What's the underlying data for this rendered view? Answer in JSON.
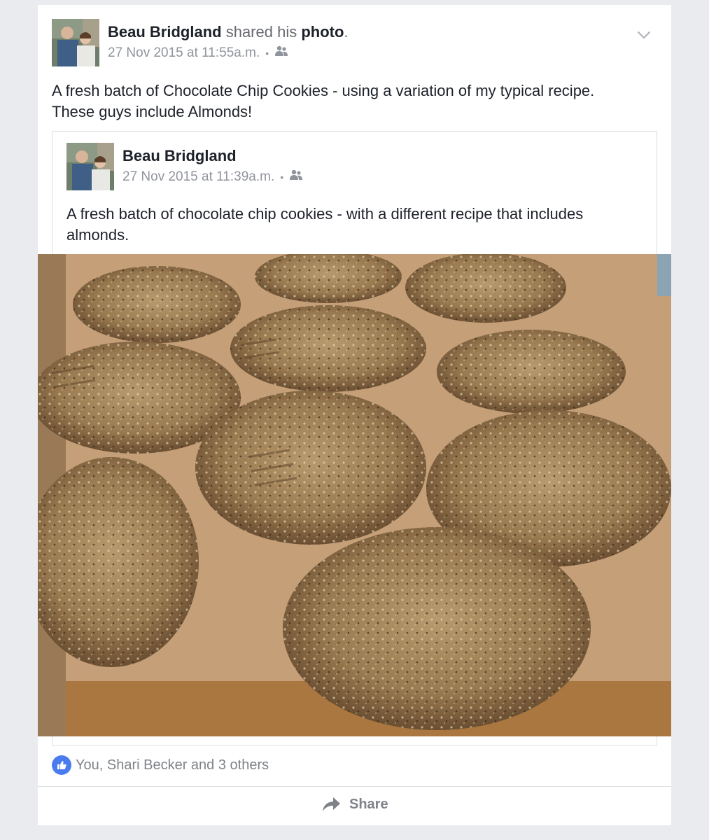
{
  "post": {
    "author": "Beau Bridgland",
    "action_prefix": "shared his",
    "action_object": "photo",
    "action_suffix": ".",
    "timestamp": "27 Nov 2015 at 11:55a.m.",
    "separator": "•",
    "audience_icon": "friends-icon",
    "text_line1": "A fresh batch of Chocolate Chip Cookies - using a variation of my typical recipe.",
    "text_line2": "These guys include Almonds!"
  },
  "shared_post": {
    "author": "Beau Bridgland",
    "timestamp": "27 Nov 2015 at 11:39a.m.",
    "separator": "•",
    "audience_icon": "friends-icon",
    "text_line1": "A fresh batch of chocolate chip cookies - with a different recipe that includes",
    "text_line2": "almonds."
  },
  "reactions": {
    "icon": "like-icon",
    "text": "You, Shari Becker and 3 others"
  },
  "actions": {
    "share_label": "Share",
    "share_icon": "share-arrow-icon"
  },
  "colors": {
    "like_blue": "#4a7cf0",
    "text_dark": "#1d2129",
    "text_grey": "#90949c"
  }
}
